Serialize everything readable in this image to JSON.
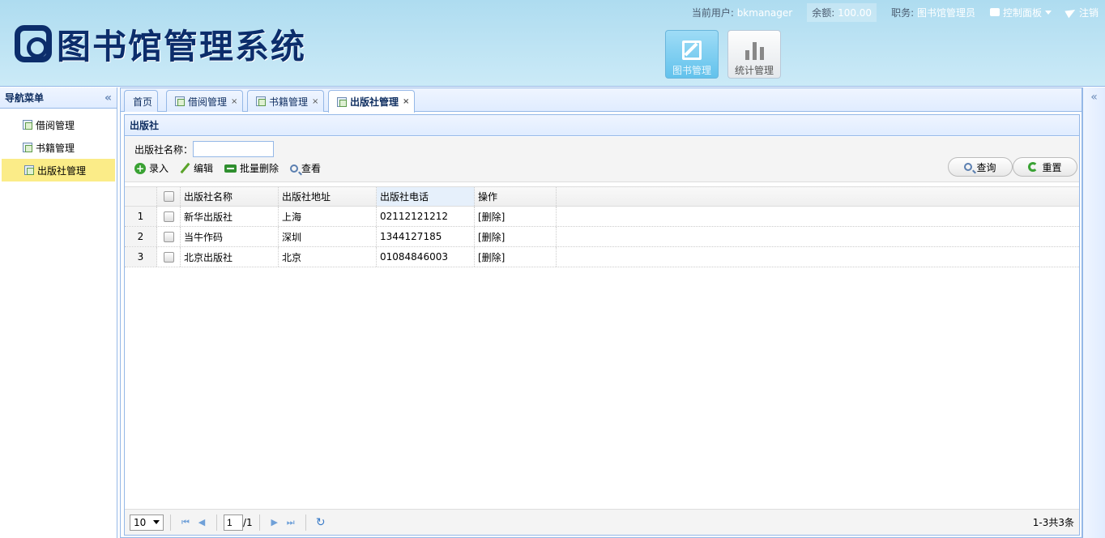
{
  "app": {
    "title": "图书馆管理系统"
  },
  "userbar": {
    "user_label": "当前用户:",
    "user_value": "bkmanager",
    "balance_label": "余额:",
    "balance_value": "100.00",
    "role_label": "职务:",
    "role_value": "图书馆管理员",
    "control_panel": "控制面板",
    "logout": "注销"
  },
  "modules": [
    {
      "label": "图书管理",
      "icon": "edit-icon",
      "active": true
    },
    {
      "label": "统计管理",
      "icon": "bar-chart-icon",
      "active": false
    }
  ],
  "sidebar": {
    "title": "导航菜单",
    "collapse_glyph": "«",
    "items": [
      {
        "label": "借阅管理",
        "selected": false
      },
      {
        "label": "书籍管理",
        "selected": false
      },
      {
        "label": "出版社管理",
        "selected": true
      }
    ]
  },
  "rightbar": {
    "collapse_glyph": "«"
  },
  "tabs": [
    {
      "label": "首页",
      "closable": false,
      "active": false
    },
    {
      "label": "借阅管理",
      "closable": true,
      "active": false
    },
    {
      "label": "书籍管理",
      "closable": true,
      "active": false
    },
    {
      "label": "出版社管理",
      "closable": true,
      "active": true
    }
  ],
  "tab_close_glyph": "×",
  "panel": {
    "title": "出版社"
  },
  "search": {
    "label": "出版社名称：",
    "value": "",
    "placeholder": ""
  },
  "actions": {
    "add": "录入",
    "edit": "编辑",
    "batch_delete": "批量删除",
    "view": "查看"
  },
  "buttons": {
    "query": "查询",
    "reset": "重置"
  },
  "table": {
    "columns": [
      "出版社名称",
      "出版社地址",
      "出版社电话",
      "操作"
    ],
    "rows": [
      {
        "no": "1",
        "name": "新华出版社",
        "address": "上海",
        "phone": "02112121212",
        "op": "[删除]"
      },
      {
        "no": "2",
        "name": "当牛作码",
        "address": "深圳",
        "phone": "1344127185",
        "op": "[删除]"
      },
      {
        "no": "3",
        "name": "北京出版社",
        "address": "北京",
        "phone": "01084846003",
        "op": "[删除]"
      }
    ]
  },
  "pager": {
    "page_size": "10",
    "current_page": "1",
    "total_pages": "/1",
    "info": "1-3共3条",
    "first_glyph": "⏮",
    "prev_glyph": "◀",
    "next_glyph": "▶",
    "last_glyph": "⏭",
    "refresh_glyph": "↻"
  },
  "colors": {
    "accent": "#95b8e7",
    "header_bg": "#aedcf0",
    "selected": "#fbec88"
  }
}
